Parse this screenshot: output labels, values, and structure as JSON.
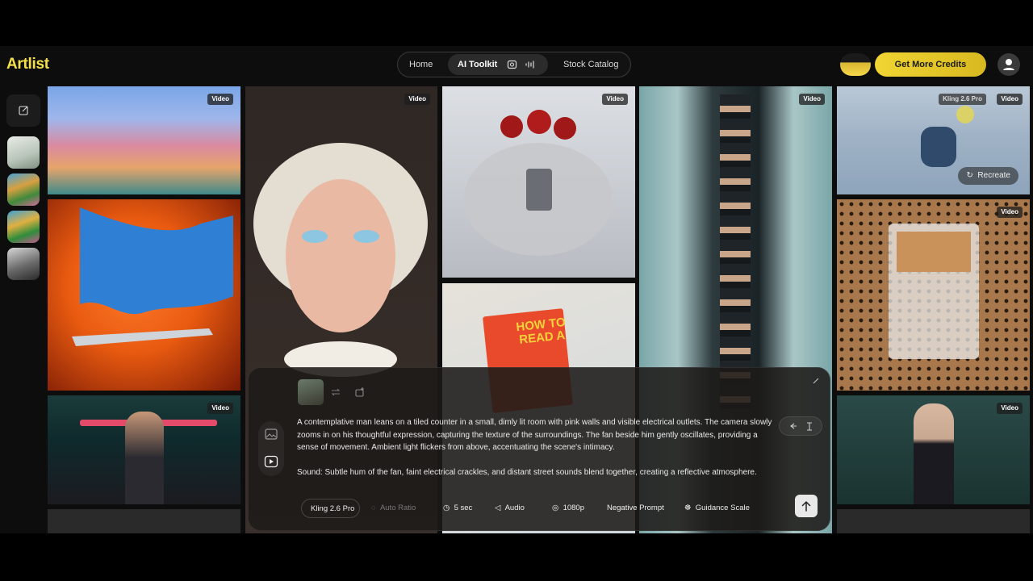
{
  "app": {
    "brand": "Artlist"
  },
  "nav": {
    "items": [
      "Home",
      "AI Toolkit",
      "Stock Catalog"
    ],
    "active": "AI Toolkit"
  },
  "header": {
    "credits_button": "Get More Credits"
  },
  "gallery": {
    "tiles": [
      {
        "badge": "Video"
      },
      {
        "badge": "Video"
      },
      {
        "badge": "Video"
      },
      {
        "badge": "Video"
      },
      {
        "badge": "Video",
        "model": "Kling 2.6 Pro",
        "action": "Recreate"
      },
      {
        "badge": "Video"
      },
      {
        "badge": "Video"
      },
      {
        "badge": "Video"
      }
    ],
    "book_text": "HOW TO READ A"
  },
  "prompt": {
    "paragraph1": "A contemplative man leans on a tiled counter in a small, dimly lit room with pink walls and visible electrical outlets. The camera slowly zooms in on his thoughtful expression, capturing the texture of the surroundings. The fan beside him gently oscillates, providing a sense of movement. Ambient light flickers from above, accentuating the scene's intimacy.",
    "paragraph2": "Sound: Subtle hum of the fan, faint electrical crackles, and distant street sounds blend together, creating a reflective atmosphere.",
    "options": [
      "Kling 2.6 Pro",
      "Auto Ratio",
      "5 sec",
      "Audio",
      "1080p",
      "Negative Prompt",
      "Guidance Scale"
    ]
  },
  "colors": {
    "accent": "#f5e04a",
    "panel": "#1c1a18"
  }
}
